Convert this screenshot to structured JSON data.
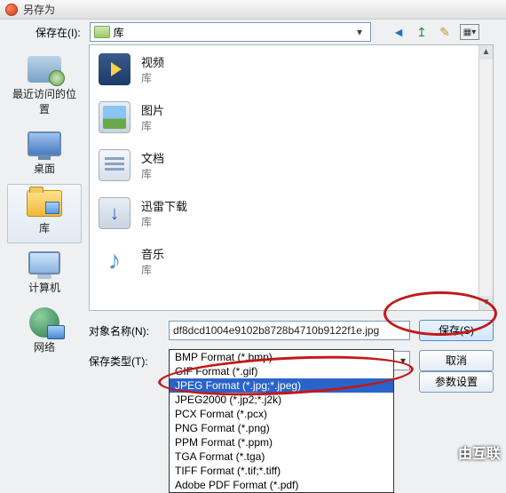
{
  "titlebar": {
    "title": "另存为"
  },
  "toolbar": {
    "save_in_label": "保存在(I):",
    "location": "库"
  },
  "places": [
    {
      "label": "最近访问的位置",
      "icon": "recent"
    },
    {
      "label": "桌面",
      "icon": "desktop"
    },
    {
      "label": "库",
      "icon": "lib",
      "selected": true
    },
    {
      "label": "计算机",
      "icon": "computer"
    },
    {
      "label": "网络",
      "icon": "network"
    }
  ],
  "files": [
    {
      "name": "视频",
      "desc": "库",
      "icon": "video"
    },
    {
      "name": "图片",
      "desc": "库",
      "icon": "img"
    },
    {
      "name": "文档",
      "desc": "库",
      "icon": "doc"
    },
    {
      "name": "迅雷下载",
      "desc": "库",
      "icon": "dl"
    },
    {
      "name": "音乐",
      "desc": "库",
      "icon": "music"
    }
  ],
  "form": {
    "filename_label": "对象名称(N):",
    "filename_value": "df8dcd1004e9102b8728b4710b9122f1e.jpg",
    "type_label": "保存类型(T):",
    "type_value": "JPEG Format (*.jpg;*.jpeg)",
    "save_btn": "保存(S)",
    "cancel_btn": "取消",
    "params_btn": "参数设置"
  },
  "type_options": [
    "BMP Format (*.bmp)",
    "GIF Format (*.gif)",
    "JPEG Format (*.jpg;*.jpeg)",
    "JPEG2000 (*.jp2;*.j2k)",
    "PCX Format (*.pcx)",
    "PNG Format (*.png)",
    "PPM Format (*.ppm)",
    "TGA Format (*.tga)",
    "TIFF Format (*.tif;*.tiff)",
    "Adobe PDF Format (*.pdf)"
  ],
  "type_highlight_index": 2,
  "watermark": "由互联"
}
